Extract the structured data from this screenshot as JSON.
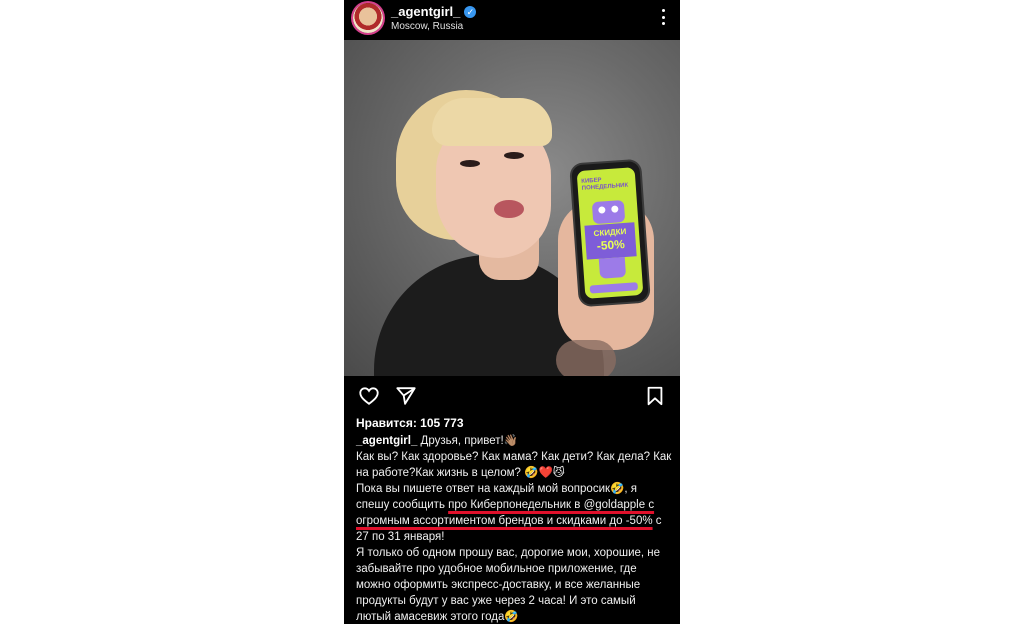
{
  "post": {
    "username": "_agentgirl_",
    "location": "Moscow, Russia",
    "verified_mark": "✓",
    "photo": {
      "screen_title": "КИБЕР ПОНЕДЕЛЬНИК",
      "badge_line1": "СКИДКИ",
      "badge_line2": "-50%"
    },
    "likes": "Нравится: 105 773",
    "caption": {
      "author": "_agentgirl_",
      "line1": " Друзья, привет!👋🏽",
      "line2": "Как вы? Как здоровье? Как мама? Как дети? Как дела? Как на работе?Как жизнь в целом? 🤣❤️😼",
      "line3a": "Пока вы пишете ответ на каждый мой вопросик🤣, я спешу сообщить ",
      "line3b": "про Киберпонедельник в @goldapple с огромным ассортиментом брендов и скидками до -50%",
      "line3c": " с 27 по 31 января!",
      "line4": "Я только об одном прошу вас, дорогие мои, хорошие, не забывайте про удобное мобильное приложение, где можно оформить экспресс-доставку, и все желанные продукты будут у вас уже через 2 часа! И это самый лютый амасевиж этого года🤣"
    }
  },
  "colors": {
    "background": "#000000",
    "verified": "#3897f0",
    "underline": "#e0102b",
    "promo_screen": "#c7ea3b",
    "promo_purple": "#7e5dd8"
  },
  "icons": [
    "heart-icon",
    "share-icon",
    "bookmark-icon",
    "more-options-icon",
    "verified-icon"
  ]
}
